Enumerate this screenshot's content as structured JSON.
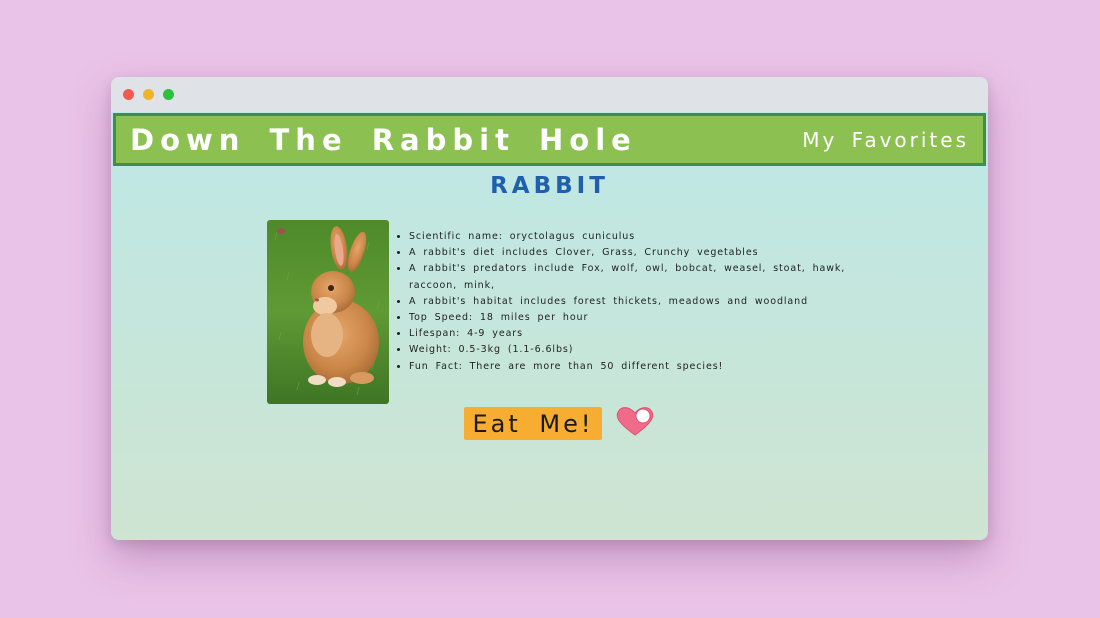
{
  "header": {
    "site_title": "Down The Rabbit Hole",
    "nav_favorites": "My Favorites"
  },
  "main": {
    "heading": "RABBIT",
    "facts": [
      "Scientific name: oryctolagus cuniculus",
      "A rabbit's diet includes Clover, Grass, Crunchy vegetables",
      "A rabbit's predators include Fox, wolf, owl, bobcat, weasel, stoat, hawk, raccoon, mink,",
      "A rabbit's habitat includes forest thickets, meadows and woodland",
      "Top Speed: 18 miles per hour",
      "Lifespan: 4-9 years",
      "Weight: 0.5-3kg (1.1-6.6lbs)",
      "Fun Fact: There are more than 50 different species!"
    ],
    "button_label": "Eat Me!",
    "favorite_icon": "heart-toggle-icon"
  },
  "colors": {
    "page_background": "#eac3e8",
    "banner": "#8cc152",
    "banner_border": "#3e8e4f",
    "heading": "#1f5fae",
    "button": "#f6ad31",
    "heart": "#f06b8a"
  }
}
